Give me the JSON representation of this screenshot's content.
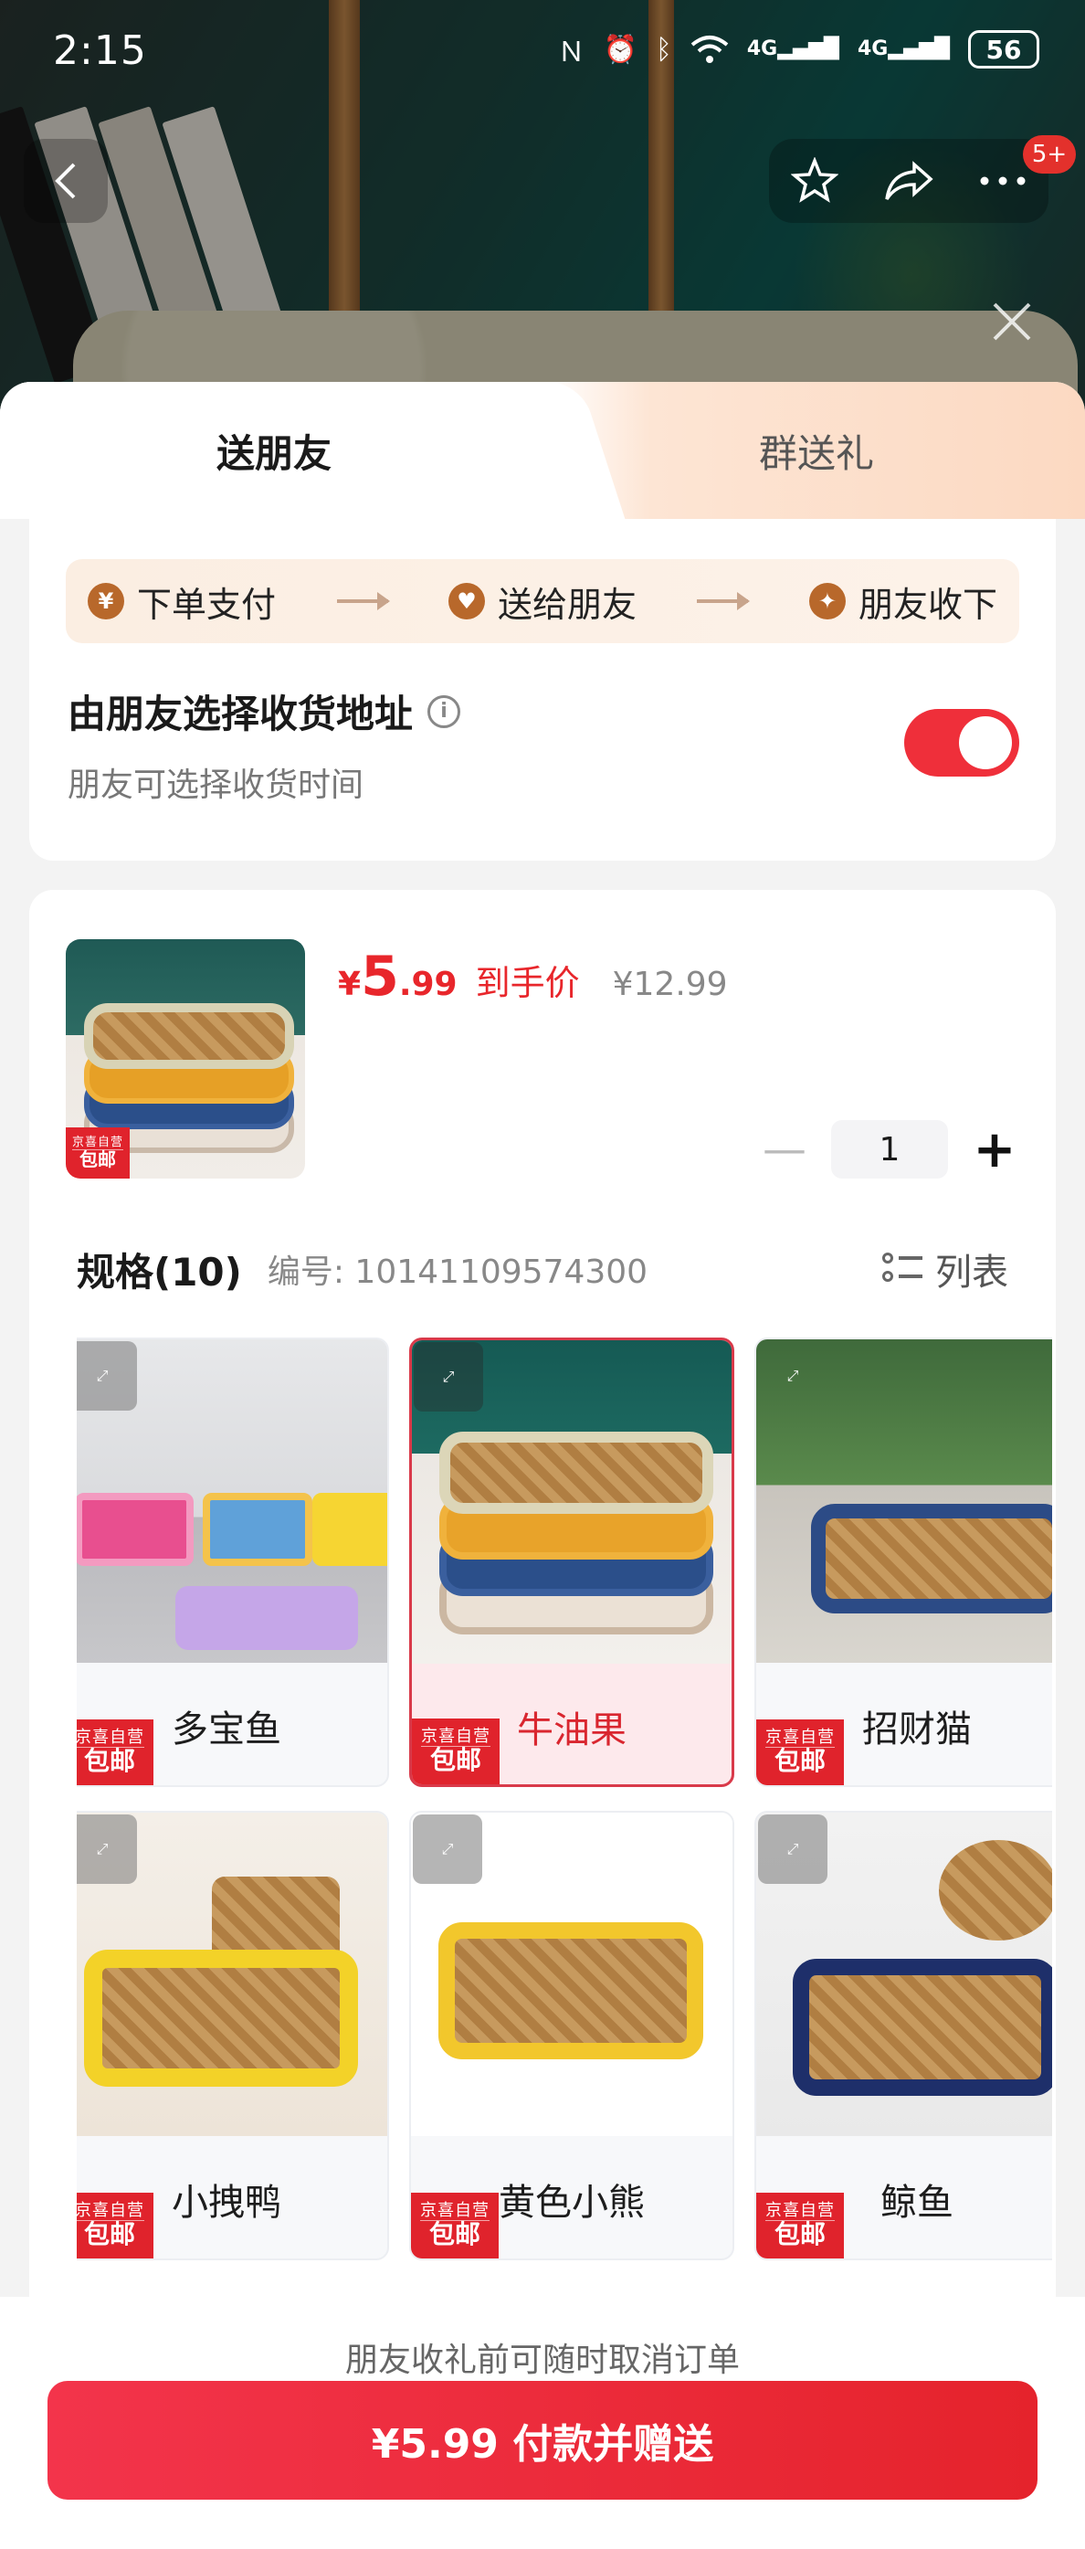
{
  "status_bar": {
    "time": "2:15",
    "net1": "4G",
    "net2": "4G",
    "battery": "56"
  },
  "nav": {
    "badge": "5+"
  },
  "tabs": [
    {
      "label": "送朋友"
    },
    {
      "label": "群送礼"
    }
  ],
  "flow": {
    "steps": [
      {
        "label": "下单支付",
        "icon": "¥"
      },
      {
        "label": "送给朋友",
        "icon": "♥"
      },
      {
        "label": "朋友收下",
        "icon": "✦"
      }
    ]
  },
  "address": {
    "title": "由朋友选择收货地址",
    "subtitle": "朋友可选择收货时间",
    "toggle_on": true
  },
  "product": {
    "currency": "¥",
    "price_int": "5",
    "price_dec": ".99",
    "price_tag": "到手价",
    "original_price": "¥12.99",
    "quantity": "1",
    "badge_top": "京喜自营",
    "badge_bottom": "包邮"
  },
  "spec": {
    "title": "规格(10)",
    "code": "编号: 10141109574300",
    "list_label": "列表"
  },
  "options": [
    {
      "label": "多宝鱼",
      "selected": false
    },
    {
      "label": "牛油果",
      "selected": true
    },
    {
      "label": "招财猫",
      "selected": false
    },
    {
      "label": "小拽鸭",
      "selected": false
    },
    {
      "label": "黄色小熊",
      "selected": false
    },
    {
      "label": "鲸鱼",
      "selected": false
    }
  ],
  "footer": {
    "note": "朋友收礼前可随时取消订单",
    "pay_label": "¥5.99 付款并赠送"
  },
  "colors": {
    "accent": "#e8262b",
    "toggle": "#ef2f3a",
    "selected_bg": "#fde9ec"
  }
}
